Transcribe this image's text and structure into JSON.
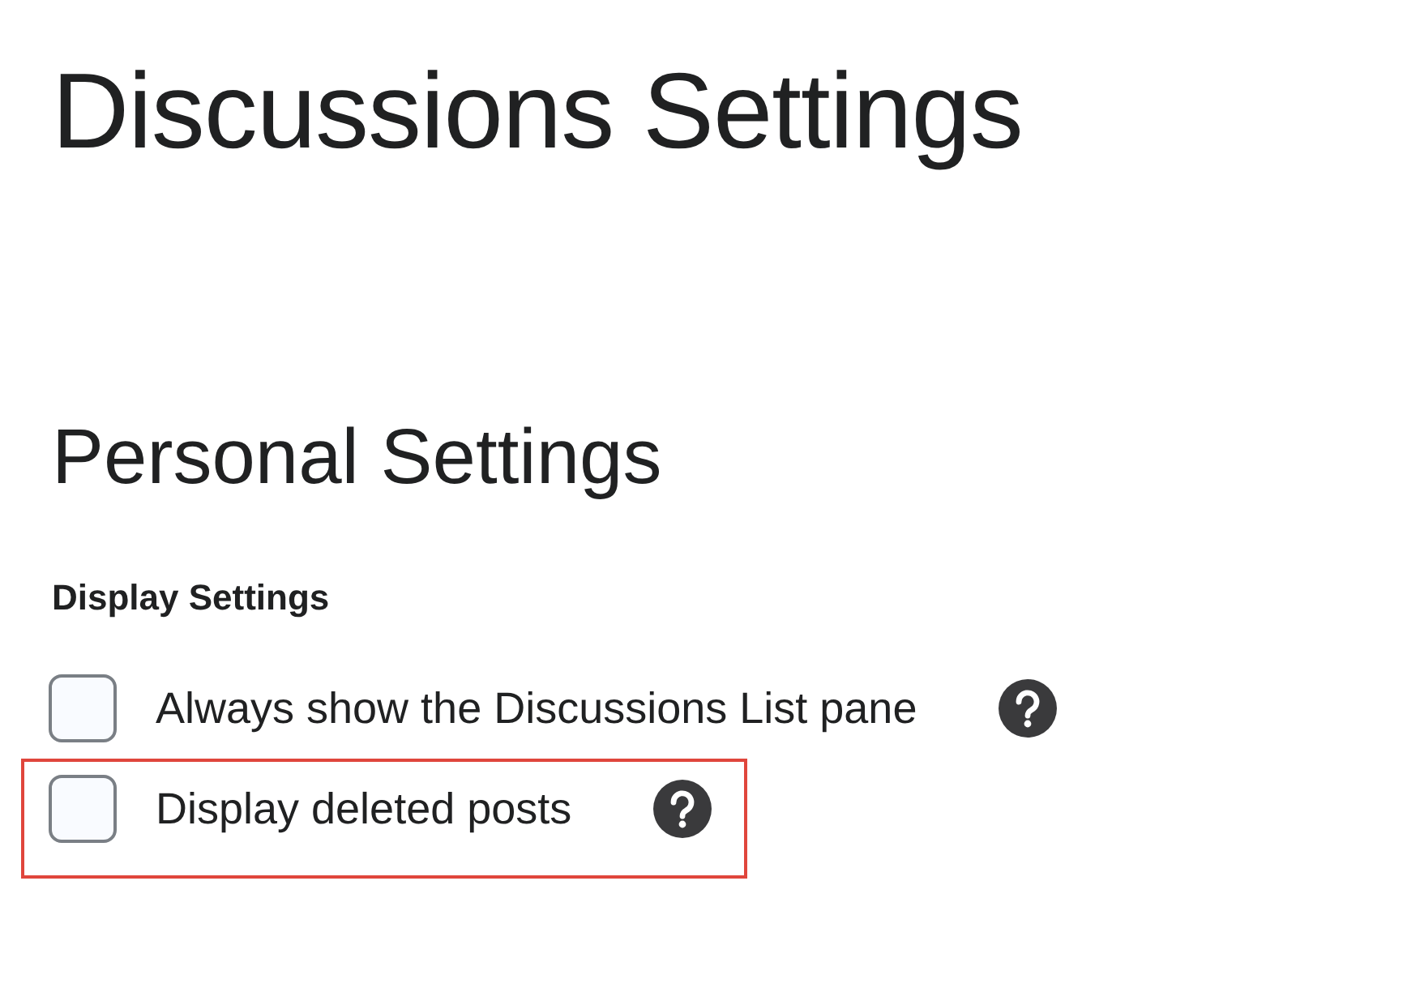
{
  "page_title": "Discussions Settings",
  "section_title": "Personal Settings",
  "group_label": "Display Settings",
  "options": [
    {
      "label": "Always show the Discussions List pane",
      "checked": false,
      "highlighted": false
    },
    {
      "label": "Display deleted posts",
      "checked": false,
      "highlighted": true
    }
  ]
}
